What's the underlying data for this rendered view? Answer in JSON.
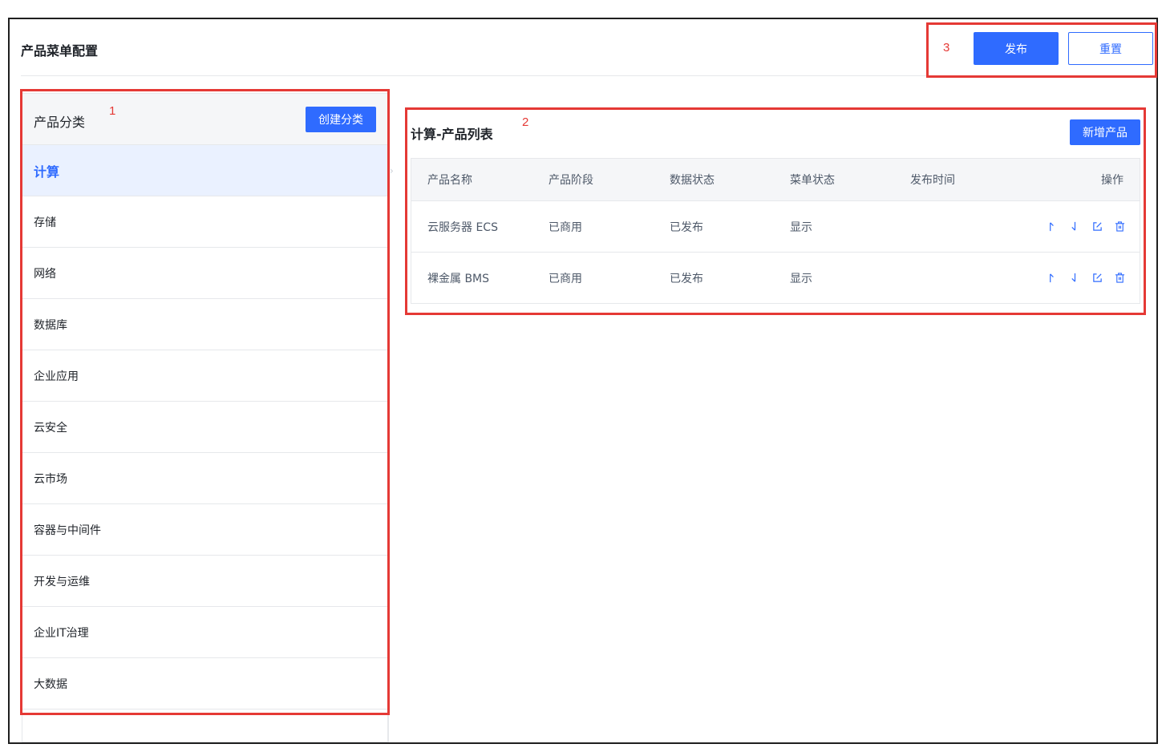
{
  "header": {
    "title": "产品菜单配置",
    "publish_label": "发布",
    "reset_label": "重置"
  },
  "annotations": {
    "one": "1",
    "two": "2",
    "three": "3"
  },
  "categories": {
    "title": "产品分类",
    "create_label": "创建分类",
    "items": [
      "计算",
      "存储",
      "网络",
      "数据库",
      "企业应用",
      "云安全",
      "云市场",
      "容器与中间件",
      "开发与运维",
      "企业IT治理",
      "大数据"
    ],
    "active_index": 0
  },
  "product_list": {
    "title": "计算-产品列表",
    "add_label": "新增产品",
    "columns": [
      "产品名称",
      "产品阶段",
      "数据状态",
      "菜单状态",
      "发布时间",
      "操作"
    ],
    "rows": [
      {
        "name": "云服务器 ECS",
        "stage": "已商用",
        "data_status": "已发布",
        "menu_status": "显示",
        "publish_time": ""
      },
      {
        "name": "裸金属 BMS",
        "stage": "已商用",
        "data_status": "已发布",
        "menu_status": "显示",
        "publish_time": ""
      }
    ],
    "row_actions": [
      "arrow-up-icon",
      "arrow-down-icon",
      "edit-icon",
      "trash-icon"
    ]
  },
  "colors": {
    "accent": "#2f6bff",
    "annotation": "#e53935",
    "active_bg": "#eaf1ff",
    "header_bg": "#f5f6f8"
  }
}
